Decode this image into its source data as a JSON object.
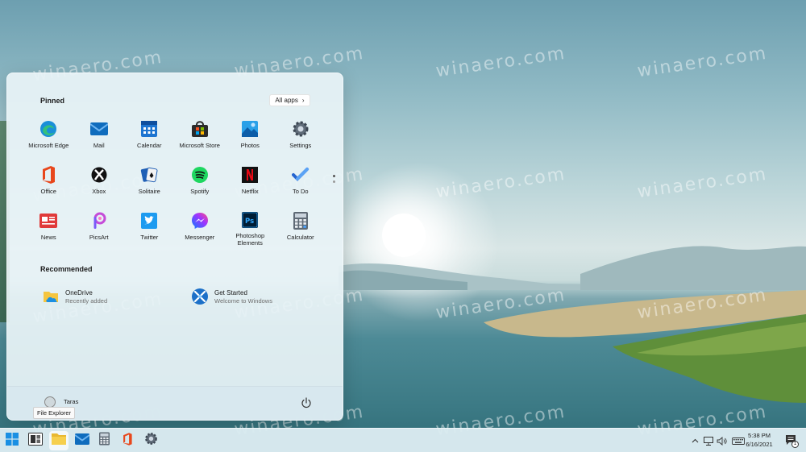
{
  "watermark": "winaero.com",
  "start_menu": {
    "pinned_title": "Pinned",
    "all_apps_label": "All apps",
    "pinned": [
      {
        "label": "Microsoft Edge",
        "icon": "edge-icon"
      },
      {
        "label": "Mail",
        "icon": "mail-icon"
      },
      {
        "label": "Calendar",
        "icon": "calendar-icon"
      },
      {
        "label": "Microsoft Store",
        "icon": "store-icon"
      },
      {
        "label": "Photos",
        "icon": "photos-icon"
      },
      {
        "label": "Settings",
        "icon": "settings-icon"
      },
      {
        "label": "Office",
        "icon": "office-icon"
      },
      {
        "label": "Xbox",
        "icon": "xbox-icon"
      },
      {
        "label": "Solitaire",
        "icon": "solitaire-icon"
      },
      {
        "label": "Spotify",
        "icon": "spotify-icon"
      },
      {
        "label": "Netflix",
        "icon": "netflix-icon"
      },
      {
        "label": "To Do",
        "icon": "todo-icon"
      },
      {
        "label": "News",
        "icon": "news-icon"
      },
      {
        "label": "PicsArt",
        "icon": "picsart-icon"
      },
      {
        "label": "Twitter",
        "icon": "twitter-icon"
      },
      {
        "label": "Messenger",
        "icon": "messenger-icon"
      },
      {
        "label": "Photoshop Elements",
        "icon": "photoshop-icon"
      },
      {
        "label": "Calculator",
        "icon": "calculator-icon"
      }
    ],
    "recommended_title": "Recommended",
    "recommended": [
      {
        "title": "OneDrive",
        "subtitle": "Recently added",
        "icon": "onedrive-icon"
      },
      {
        "title": "Get Started",
        "subtitle": "Welcome to Windows",
        "icon": "get-started-icon"
      }
    ],
    "user_name": "Taras",
    "tooltip": "File Explorer"
  },
  "taskbar": {
    "apps": [
      "start-icon",
      "task-view-icon",
      "file-explorer-icon",
      "mail-icon",
      "calculator-icon",
      "office-icon",
      "settings-icon"
    ],
    "time": "5:38 PM",
    "date": "6/16/2021",
    "notification_count": "1"
  }
}
